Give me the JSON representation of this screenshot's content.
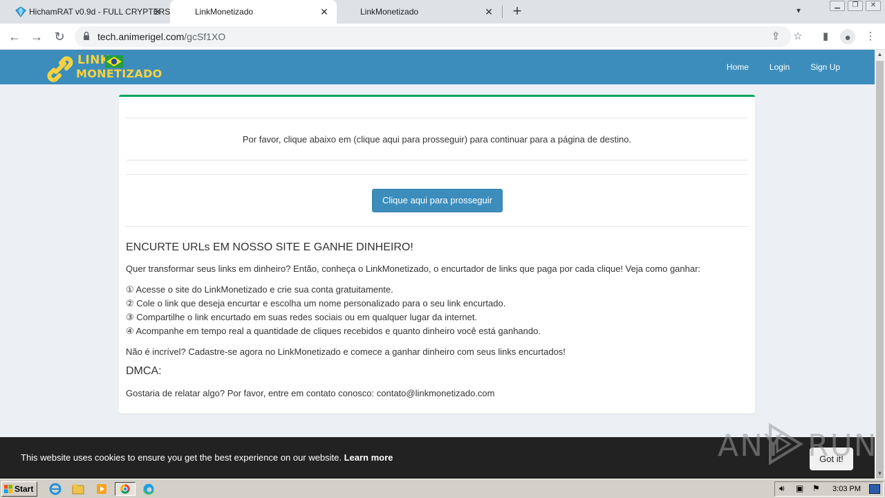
{
  "browser": {
    "tabs": [
      {
        "title": "HichamRAT v0.9d - FULL CRYPTERS",
        "active": false
      },
      {
        "title": "LinkMonetizado",
        "active": true
      },
      {
        "title": "LinkMonetizado",
        "active": false
      }
    ],
    "new_tab_label": "+",
    "url_domain": "tech.animerigel.com",
    "url_path": "/gcSf1XO"
  },
  "site": {
    "logo_line1": "LINK",
    "logo_line2": "MONETIZADO",
    "nav": [
      {
        "label": "Home"
      },
      {
        "label": "Login"
      },
      {
        "label": "Sign Up"
      }
    ]
  },
  "content": {
    "notice": "Por favor, clique abaixo em (clique aqui para prosseguir) para continuar para a página de destino.",
    "proceed_button": "Clique aqui para prosseguir",
    "heading": "ENCURTE URLs EM NOSSO SITE E GANHE DINHEIRO!",
    "intro": "Quer transformar seus links em dinheiro? Então, conheça o LinkMonetizado, o encurtador de links que paga por cada clique! Veja como ganhar:",
    "steps": [
      "① Acesse o site do LinkMonetizado e crie sua conta gratuitamente.",
      "② Cole o link que deseja encurtar e escolha um nome personalizado para o seu link encurtado.",
      "③ Compartilhe o link encurtado em suas redes sociais ou em qualquer lugar da internet.",
      "④ Acompanhe em tempo real a quantidade de cliques recebidos e quanto dinheiro você está ganhando."
    ],
    "closing": "Não é incrível? Cadastre-se agora no LinkMonetizado e comece a ganhar dinheiro com seus links encurtados!",
    "dmca_heading": "DMCA:",
    "dmca_text": "Gostaria de relatar algo? Por favor, entre em contato conosco: contato@linkmonetizado.com"
  },
  "cookie": {
    "message": "This website uses cookies to ensure you get the best experience on our website.",
    "learn_more": "Learn more",
    "button": "Got it!"
  },
  "watermark": {
    "text_left": "ANY",
    "text_right": "RUN"
  },
  "taskbar": {
    "start_label": "Start",
    "clock": "3:03 PM"
  },
  "colors": {
    "header_blue": "#3c8dbc",
    "card_top_green": "#00a65a",
    "logo_yellow": "#f7d33f",
    "cookie_bar": "#222222"
  }
}
